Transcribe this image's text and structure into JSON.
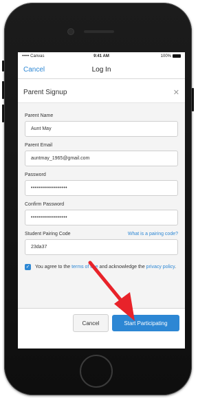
{
  "status_bar": {
    "carrier": "••••• Canvas",
    "time": "9:41 AM",
    "battery": "100%"
  },
  "nav": {
    "cancel_label": "Cancel",
    "title": "Log In"
  },
  "modal": {
    "title": "Parent Signup",
    "close_icon": "close-icon"
  },
  "form": {
    "parent_name": {
      "label": "Parent Name",
      "value": "Aunt May"
    },
    "parent_email": {
      "label": "Parent Email",
      "value": "auntmay_1965@gmail.com"
    },
    "password": {
      "label": "Password",
      "value": "••••••••••••••••••"
    },
    "confirm_password": {
      "label": "Confirm Password",
      "value": "••••••••••••••••••"
    },
    "pairing_code": {
      "label": "Student Pairing Code",
      "help_link": "What is a pairing code?",
      "value": "23da37"
    }
  },
  "agreement": {
    "checked": true,
    "prefix": "You agree to the",
    "terms_link": "terms of use",
    "middle": "and acknowledge the",
    "privacy_link": "privacy policy",
    "suffix": "."
  },
  "footer": {
    "cancel_label": "Cancel",
    "start_label": "Start Participating"
  },
  "colors": {
    "accent": "#2d87d4",
    "arrow": "#e8232a"
  }
}
